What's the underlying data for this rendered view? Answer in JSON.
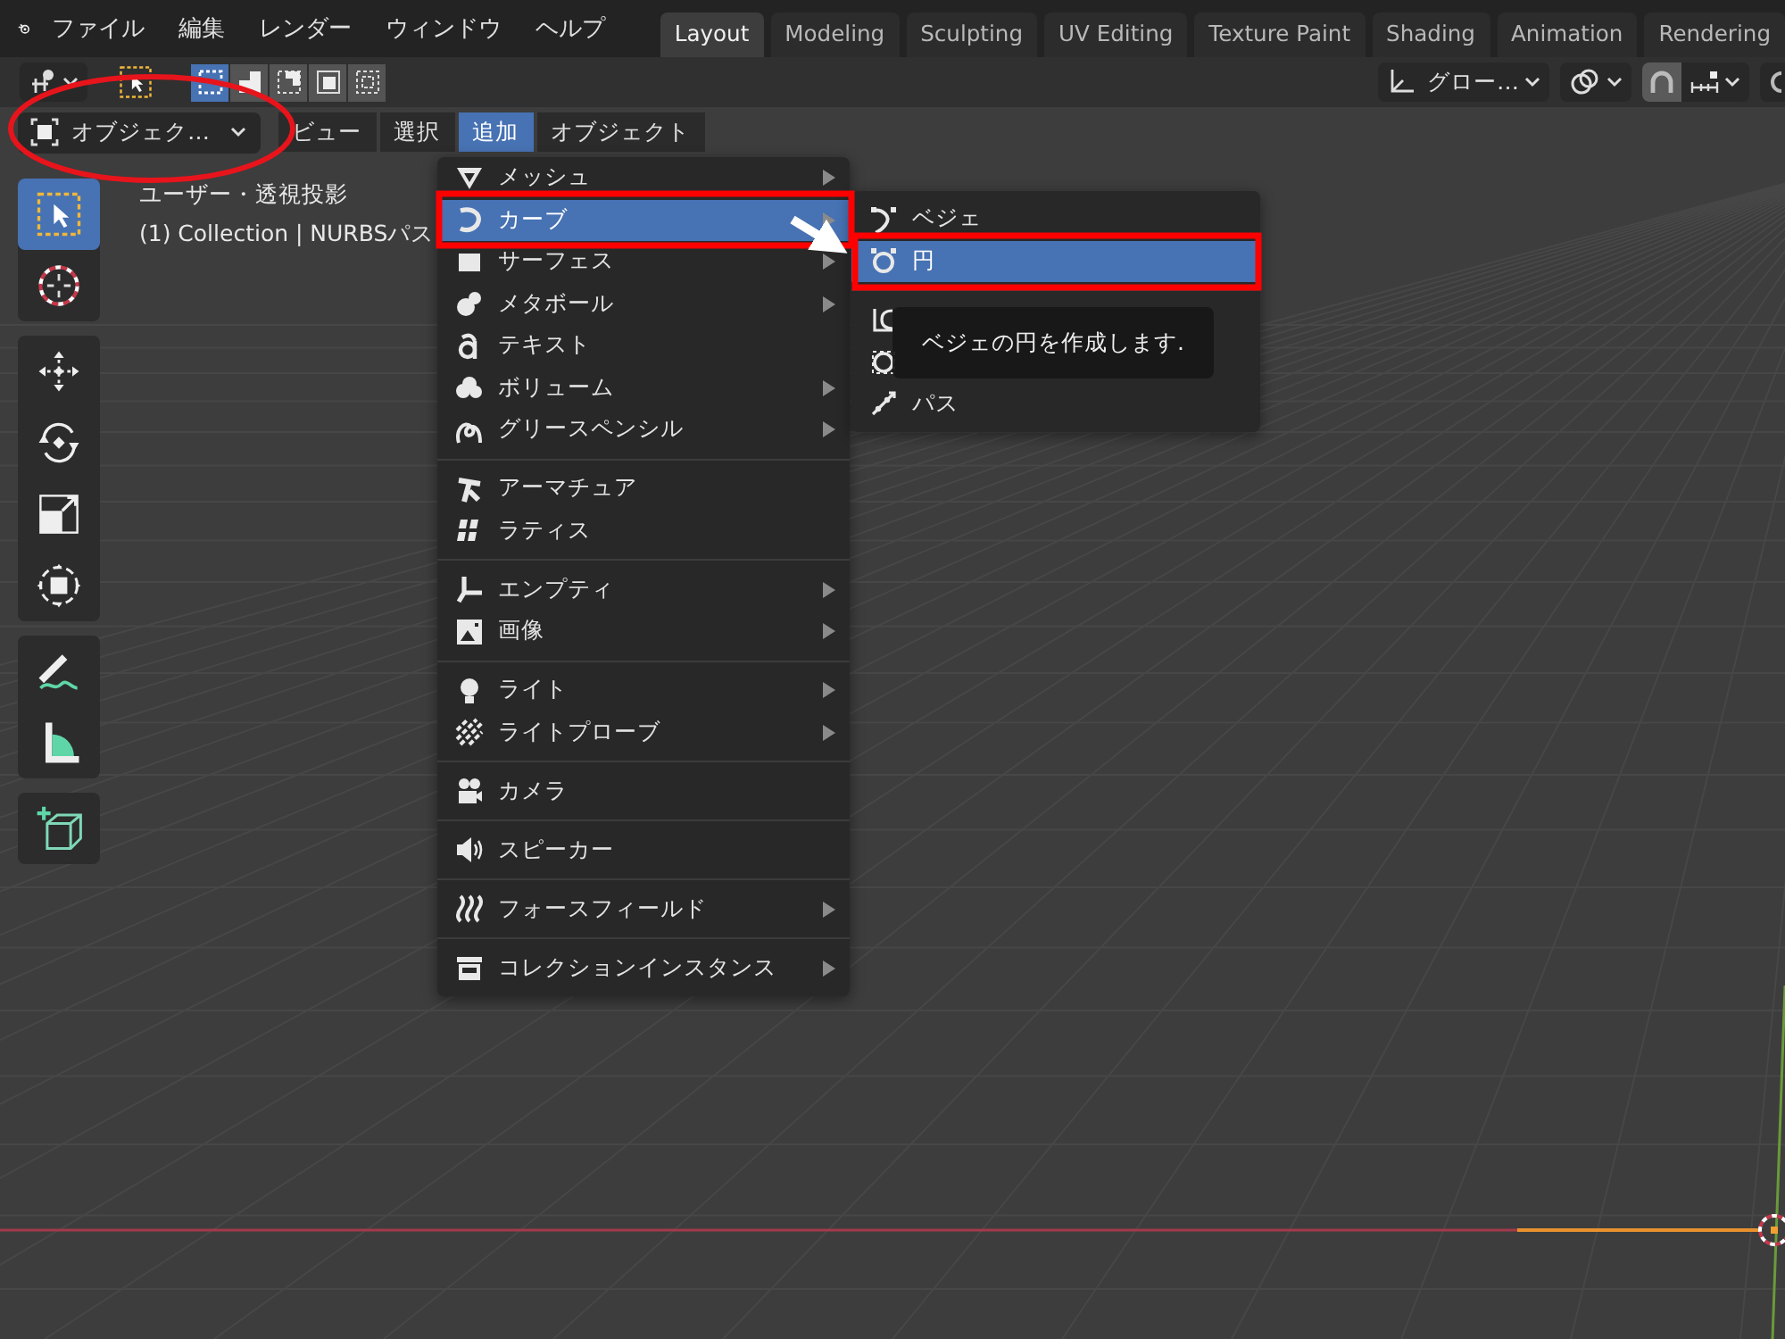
{
  "top_bar": {
    "menus": [
      "ファイル",
      "編集",
      "レンダー",
      "ウィンドウ",
      "ヘルプ"
    ],
    "workspace_tabs": [
      {
        "label": "Layout",
        "selected": true
      },
      {
        "label": "Modeling",
        "selected": false
      },
      {
        "label": "Sculpting",
        "selected": false
      },
      {
        "label": "UV Editing",
        "selected": false
      },
      {
        "label": "Texture Paint",
        "selected": false
      },
      {
        "label": "Shading",
        "selected": false
      },
      {
        "label": "Animation",
        "selected": false
      },
      {
        "label": "Rendering",
        "selected": false
      }
    ]
  },
  "tool_header": {
    "select_modes": [
      {
        "kind": "new",
        "selected": true
      },
      {
        "kind": "extend",
        "selected": false
      },
      {
        "kind": "subtract",
        "selected": false
      },
      {
        "kind": "intersect",
        "selected": false
      },
      {
        "kind": "invert",
        "selected": false
      }
    ],
    "orientation": "グロー…",
    "snap_on": true
  },
  "viewport_header": {
    "mode": "オブジェク…",
    "menus": [
      {
        "label": "ビュー",
        "selected": false
      },
      {
        "label": "選択",
        "selected": false
      },
      {
        "label": "追加",
        "selected": true
      },
      {
        "label": "オブジェクト",
        "selected": false
      }
    ]
  },
  "viewport": {
    "view_name": "ユーザー・透視投影",
    "object_info": "(1) Collection | NURBSパス"
  },
  "toolbar": {
    "tools": [
      {
        "kind": "select",
        "selected": true
      },
      {
        "kind": "cursor",
        "selected": false
      },
      {
        "kind": "move",
        "selected": false
      },
      {
        "kind": "rotate",
        "selected": false
      },
      {
        "kind": "scale",
        "selected": false
      },
      {
        "kind": "transform",
        "selected": false
      },
      {
        "kind": "annotate",
        "selected": false
      },
      {
        "kind": "measure",
        "selected": false
      },
      {
        "kind": "add_cube",
        "selected": false
      }
    ]
  },
  "add_menu": {
    "sections": [
      [
        {
          "label": "メッシュ",
          "kind": "mesh",
          "submenu": true,
          "selected": false
        },
        {
          "label": "カーブ",
          "kind": "curve",
          "submenu": true,
          "selected": true
        },
        {
          "label": "サーフェス",
          "kind": "surface",
          "submenu": true,
          "selected": false
        },
        {
          "label": "メタボール",
          "kind": "metaball",
          "submenu": true,
          "selected": false
        },
        {
          "label": "テキスト",
          "kind": "text",
          "submenu": false,
          "selected": false
        },
        {
          "label": "ボリューム",
          "kind": "volume",
          "submenu": true,
          "selected": false
        },
        {
          "label": "グリースペンシル",
          "kind": "grease_pencil",
          "submenu": true,
          "selected": false
        }
      ],
      [
        {
          "label": "アーマチュア",
          "kind": "armature",
          "submenu": false,
          "selected": false
        },
        {
          "label": "ラティス",
          "kind": "lattice",
          "submenu": false,
          "selected": false
        }
      ],
      [
        {
          "label": "エンプティ",
          "kind": "empty",
          "submenu": true,
          "selected": false
        },
        {
          "label": "画像",
          "kind": "image",
          "submenu": true,
          "selected": false
        }
      ],
      [
        {
          "label": "ライト",
          "kind": "light",
          "submenu": true,
          "selected": false
        },
        {
          "label": "ライトプローブ",
          "kind": "light_probe",
          "submenu": true,
          "selected": false
        }
      ],
      [
        {
          "label": "カメラ",
          "kind": "camera",
          "submenu": false,
          "selected": false
        }
      ],
      [
        {
          "label": "スピーカー",
          "kind": "speaker",
          "submenu": false,
          "selected": false
        }
      ],
      [
        {
          "label": "フォースフィールド",
          "kind": "force_field",
          "submenu": true,
          "selected": false
        }
      ],
      [
        {
          "label": "コレクションインスタンス",
          "kind": "collection_instance",
          "submenu": true,
          "selected": false
        }
      ]
    ]
  },
  "curve_submenu": {
    "sections": [
      [
        {
          "label": "ベジェ",
          "kind": "bezier",
          "selected": false
        },
        {
          "label": "円",
          "kind": "circle",
          "selected": true
        }
      ],
      [
        {
          "kind": "nurbs_curve",
          "selected": false
        },
        {
          "kind": "nurbs_circle",
          "selected": false
        },
        {
          "label": "パス",
          "kind": "path",
          "selected": false
        }
      ]
    ]
  },
  "tooltip": {
    "text": "ベジェの円を作成します."
  }
}
